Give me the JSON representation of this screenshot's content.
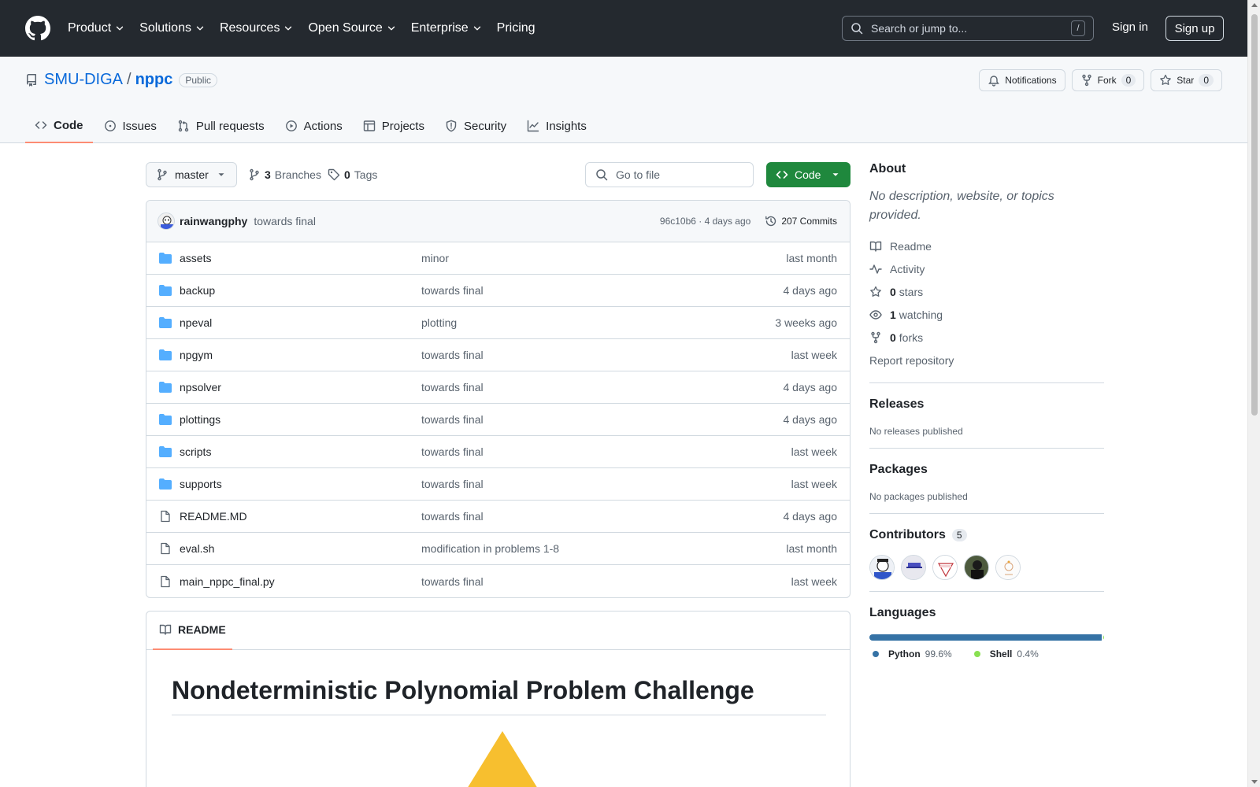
{
  "header": {
    "nav": [
      {
        "label": "Product",
        "has_menu": true
      },
      {
        "label": "Solutions",
        "has_menu": true
      },
      {
        "label": "Resources",
        "has_menu": true
      },
      {
        "label": "Open Source",
        "has_menu": true
      },
      {
        "label": "Enterprise",
        "has_menu": true
      },
      {
        "label": "Pricing",
        "has_menu": false
      }
    ],
    "search_placeholder": "Search or jump to...",
    "search_shortcut": "/",
    "sign_in": "Sign in",
    "sign_up": "Sign up"
  },
  "repo": {
    "owner": "SMU-DIGA",
    "separator": "/",
    "name": "nppc",
    "visibility": "Public",
    "notifications_label": "Notifications",
    "fork_label": "Fork",
    "fork_count": "0",
    "star_label": "Star",
    "star_count": "0",
    "tabs": [
      {
        "label": "Code",
        "icon": "code-icon",
        "active": true
      },
      {
        "label": "Issues",
        "icon": "issue-icon",
        "active": false
      },
      {
        "label": "Pull requests",
        "icon": "pull-request-icon",
        "active": false
      },
      {
        "label": "Actions",
        "icon": "play-icon",
        "active": false
      },
      {
        "label": "Projects",
        "icon": "table-icon",
        "active": false
      },
      {
        "label": "Security",
        "icon": "shield-icon",
        "active": false
      },
      {
        "label": "Insights",
        "icon": "graph-icon",
        "active": false
      }
    ]
  },
  "toolbar": {
    "branch": "master",
    "branches_count": "3",
    "branches_label": "Branches",
    "tags_count": "0",
    "tags_label": "Tags",
    "goto_placeholder": "Go to file",
    "code_button": "Code"
  },
  "last_commit": {
    "author": "rainwangphy",
    "message": "towards final",
    "meta": "96c10b6 · 4 days ago",
    "commits_label": "207 Commits"
  },
  "files": [
    {
      "name": "assets",
      "type": "folder",
      "message": "minor",
      "date": "last month"
    },
    {
      "name": "backup",
      "type": "folder",
      "message": "towards final",
      "date": "4 days ago"
    },
    {
      "name": "npeval",
      "type": "folder",
      "message": "plotting",
      "date": "3 weeks ago"
    },
    {
      "name": "npgym",
      "type": "folder",
      "message": "towards final",
      "date": "last week"
    },
    {
      "name": "npsolver",
      "type": "folder",
      "message": "towards final",
      "date": "4 days ago"
    },
    {
      "name": "plottings",
      "type": "folder",
      "message": "towards final",
      "date": "4 days ago"
    },
    {
      "name": "scripts",
      "type": "folder",
      "message": "towards final",
      "date": "last week"
    },
    {
      "name": "supports",
      "type": "folder",
      "message": "towards final",
      "date": "last week"
    },
    {
      "name": "README.MD",
      "type": "file",
      "message": "towards final",
      "date": "4 days ago"
    },
    {
      "name": "eval.sh",
      "type": "file",
      "message": "modification in problems 1-8",
      "date": "last month"
    },
    {
      "name": "main_nppc_final.py",
      "type": "file",
      "message": "towards final",
      "date": "last week"
    }
  ],
  "readme": {
    "tab_label": "README",
    "heading": "Nondeterministic Polynomial Problem Challenge"
  },
  "sidebar": {
    "about_title": "About",
    "about_desc": "No description, website, or topics provided.",
    "links": [
      {
        "icon": "book-icon",
        "strong": "",
        "text": "Readme"
      },
      {
        "icon": "pulse-icon",
        "strong": "",
        "text": "Activity"
      },
      {
        "icon": "star-icon",
        "strong": "0",
        "text": "stars"
      },
      {
        "icon": "eye-icon",
        "strong": "1",
        "text": "watching"
      },
      {
        "icon": "fork-icon",
        "strong": "0",
        "text": "forks"
      }
    ],
    "report": "Report repository",
    "releases_title": "Releases",
    "releases_text": "No releases published",
    "packages_title": "Packages",
    "packages_text": "No packages published",
    "contributors_title": "Contributors",
    "contributors_count": "5",
    "languages_title": "Languages",
    "languages": [
      {
        "name": "Python",
        "percent": "99.6%",
        "value": 99.6,
        "color": "#3572A5"
      },
      {
        "name": "Shell",
        "percent": "0.4%",
        "value": 0.4,
        "color": "#89e051"
      }
    ]
  },
  "colors": {
    "header_bg": "#24292f",
    "link": "#0969da",
    "primary_button": "#1f883d",
    "tab_underline": "#fd8c73",
    "folder": "#54aeff"
  }
}
